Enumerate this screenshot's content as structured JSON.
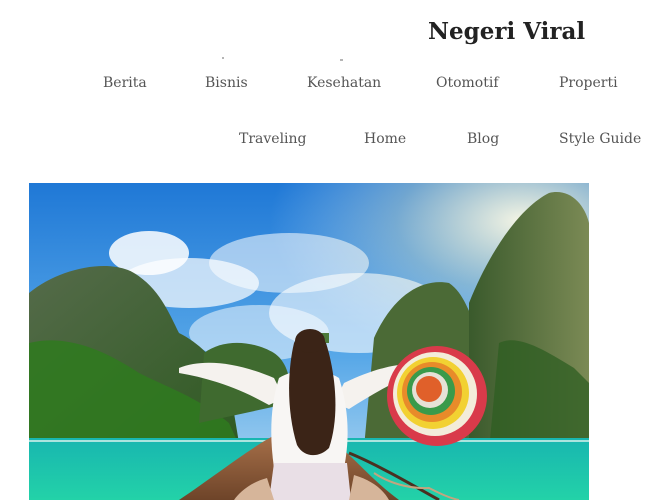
{
  "header": {
    "site_title": "Negeri Viral"
  },
  "nav": {
    "row1": [
      {
        "label": "Berita"
      },
      {
        "label": "Bisnis"
      },
      {
        "label": "Kesehatan"
      },
      {
        "label": "Otomotif"
      },
      {
        "label": "Properti"
      }
    ],
    "row2": [
      {
        "label": "Traveling"
      },
      {
        "label": "Home"
      },
      {
        "label": "Blog"
      },
      {
        "label": "Style Guide"
      }
    ]
  },
  "featured_image": {
    "icon": "featured-photo",
    "colors": {
      "sky": "#2f86d8",
      "sea": "#1fc7b0",
      "cliff": "#3f6a2f",
      "boat": "#8b5a3c",
      "hat_outer": "#d93a4a",
      "hat_inner": "#f2d132"
    }
  }
}
